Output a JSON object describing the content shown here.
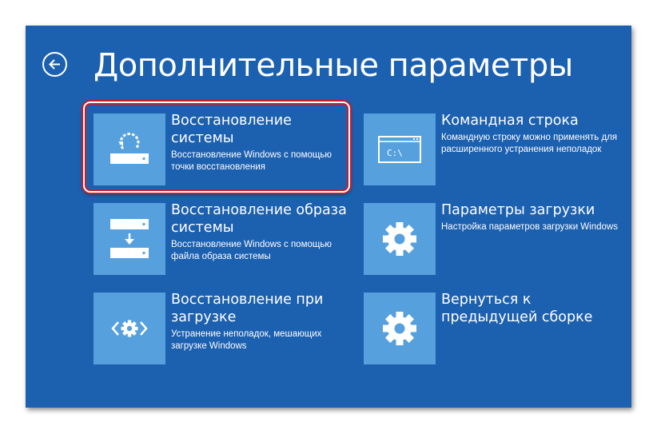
{
  "header": {
    "title": "Дополнительные параметры",
    "back_icon": "back-arrow-icon"
  },
  "options": [
    {
      "title": "Восстановление системы",
      "desc": "Восстановление Windows с помощью точки восстановления",
      "icon": "system-restore-icon",
      "selected": true
    },
    {
      "title": "Командная строка",
      "desc": "Командную строку можно применять для расширенного устранения неполадок",
      "icon": "command-prompt-icon",
      "icon_text": "C:\\",
      "selected": false
    },
    {
      "title": "Восстановление образа системы",
      "desc": "Восстановление Windows с помощью файла образа системы",
      "icon": "system-image-recovery-icon",
      "selected": false
    },
    {
      "title": "Параметры загрузки",
      "desc": "Настройка параметров загрузки Windows",
      "icon": "gear-icon",
      "selected": false
    },
    {
      "title": "Восстановление при загрузке",
      "desc": "Устранение неполадок, мешающих загрузке Windows",
      "icon": "startup-repair-icon",
      "selected": false
    },
    {
      "title": "Вернуться к предыдущей сборке",
      "desc": "",
      "icon": "gear-icon",
      "selected": false
    }
  ],
  "colors": {
    "background": "#1c60b0",
    "tile": "#55a0dd",
    "highlight_border": "#c81e2a",
    "text": "#ffffff"
  }
}
